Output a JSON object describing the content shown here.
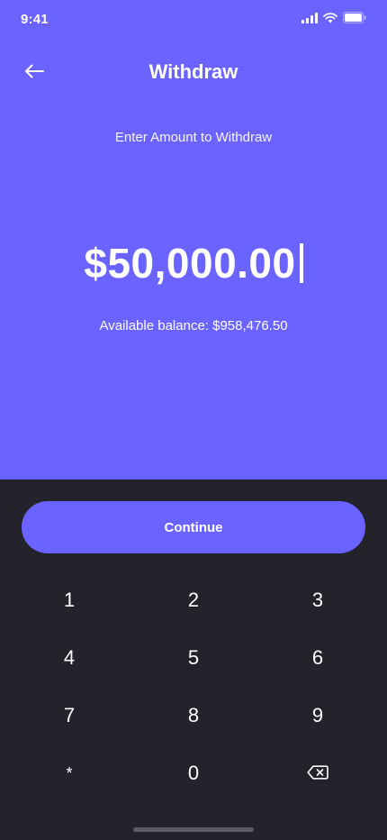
{
  "status_bar": {
    "time": "9:41",
    "icons": [
      "signal-icon",
      "wifi-icon",
      "battery-icon"
    ]
  },
  "header": {
    "title": "Withdraw",
    "back_icon": "arrow-left-icon"
  },
  "prompt": "Enter Amount to Withdraw",
  "amount": "$50,000.00",
  "balance_text": "Available balance: $958,476.50",
  "continue_label": "Continue",
  "keypad": {
    "keys": [
      [
        "1",
        "2",
        "3"
      ],
      [
        "4",
        "5",
        "6"
      ],
      [
        "7",
        "8",
        "9"
      ],
      [
        "*",
        "0",
        ""
      ]
    ],
    "delete_icon": "backspace-icon"
  },
  "colors": {
    "accent": "#6b63ff",
    "keypad_bg": "#22232b",
    "text": "#ffffff"
  }
}
